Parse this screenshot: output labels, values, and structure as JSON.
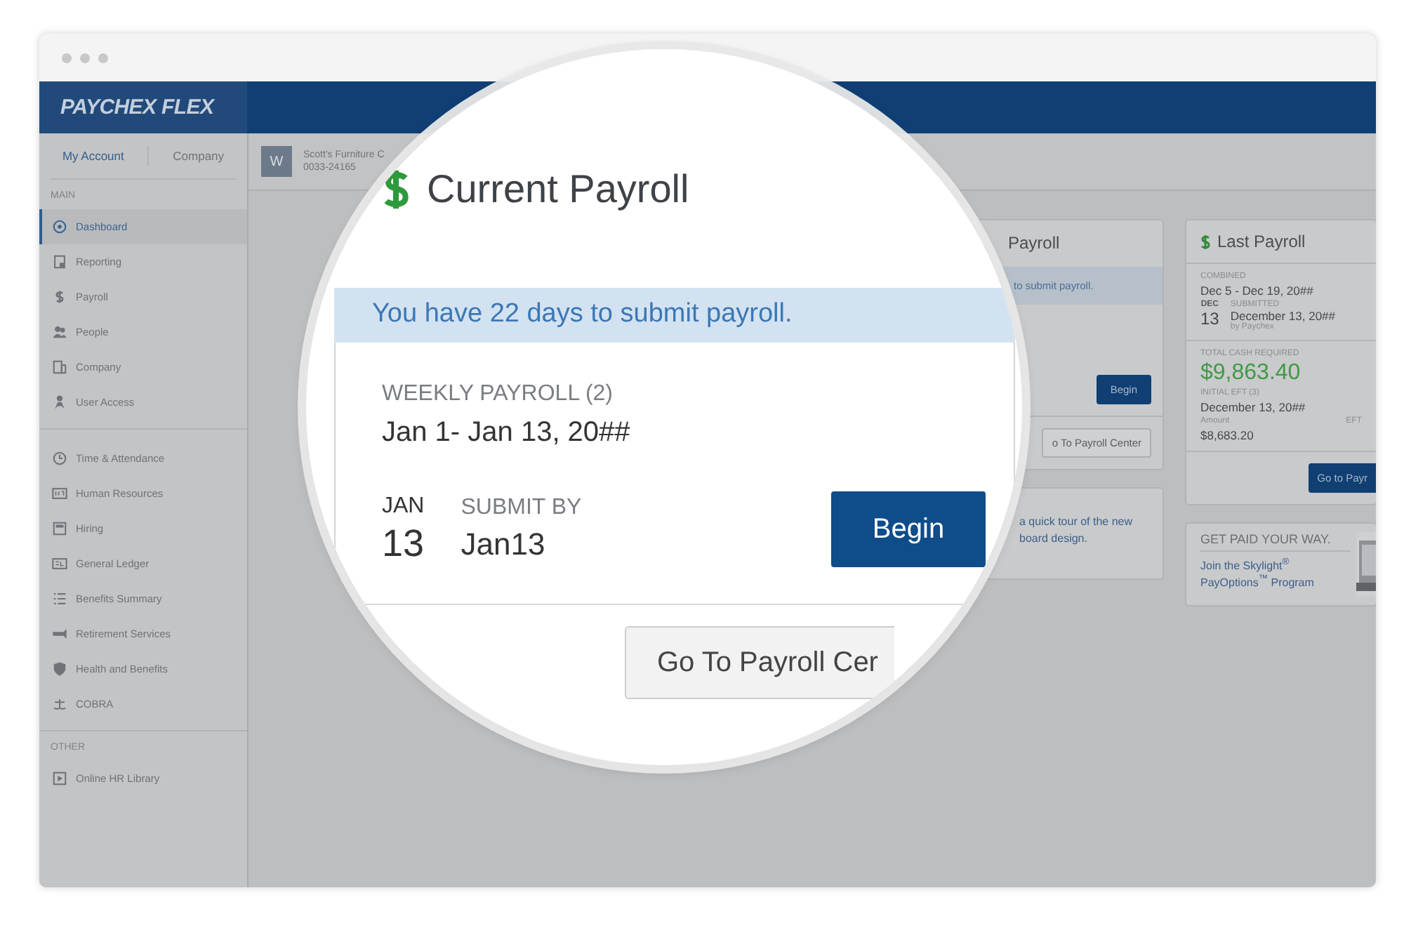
{
  "header": {
    "logo": "PAYCHEX FLEX"
  },
  "sidebar": {
    "tabs": [
      {
        "label": "My Account",
        "selected": true
      },
      {
        "label": "Company",
        "selected": false
      }
    ],
    "sections": [
      {
        "title": "MAIN",
        "items": [
          {
            "label": "Dashboard",
            "selected": true
          },
          {
            "label": "Reporting",
            "selected": false
          },
          {
            "label": "Payroll",
            "selected": false
          },
          {
            "label": "People",
            "selected": false
          },
          {
            "label": "Company",
            "selected": false
          },
          {
            "label": "User Access",
            "selected": false
          }
        ]
      },
      {
        "items": [
          {
            "label": "Time & Attendance",
            "selected": false
          },
          {
            "label": "Human Resources",
            "selected": false
          },
          {
            "label": "Hiring",
            "selected": false
          },
          {
            "label": "General Ledger",
            "selected": false
          },
          {
            "label": "Benefits Summary",
            "selected": false
          },
          {
            "label": "Retirement Services",
            "selected": false
          },
          {
            "label": "Health and Benefits",
            "selected": false
          },
          {
            "label": "COBRA",
            "selected": false
          }
        ]
      },
      {
        "title": "OTHER",
        "items": [
          {
            "label": "Online HR Library",
            "selected": false
          }
        ]
      }
    ]
  },
  "company": {
    "avatar": "W",
    "name": "Scott's Furniture C",
    "number": "0033-24165"
  },
  "payroll_card": {
    "title": "Payroll",
    "notice": "to submit payroll.",
    "begin": "Begin",
    "center": "o To Payroll Center"
  },
  "tour_card": {
    "text": "a quick tour of the new board design."
  },
  "last_payroll": {
    "title": "Last Payroll",
    "combined_label": "COMBINED",
    "combined": "Dec 5 - Dec 19, 20##",
    "month": "DEC",
    "day": "13",
    "submitted_label": "SUBMITTED",
    "submitted": "December 13, 20##",
    "by": "by Paychex",
    "total_label": "TOTAL CASH REQUIRED",
    "total": "$9,863.40",
    "eft_label": "INITIAL EFT (3)",
    "eft_date": "December 13, 20##",
    "amount_label": "Amount",
    "amount": "$8,683.20",
    "eft_col": "EFT",
    "button": "Go to Payr"
  },
  "promo": {
    "title": "GET PAID YOUR WAY.",
    "link": "Join the Skylight$^{®}$ PayOptions$^{™}$ Program"
  },
  "magnifier": {
    "title": "Current Payroll",
    "notice": "You have 22 days to submit payroll.",
    "payroll_name": "WEEKLY PAYROLL (2)",
    "period": "Jan 1- Jan 13, 20##",
    "month": "JAN",
    "day": "13",
    "submit_label": "SUBMIT BY",
    "submit_date": "Jan13",
    "begin": "Begin",
    "center": "Go To Payroll Cer"
  }
}
